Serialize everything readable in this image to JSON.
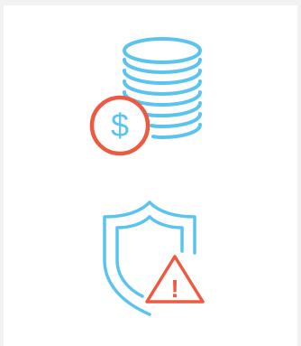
{
  "illustrations": [
    {
      "name": "coin-stack-with-dollar-icon",
      "icon": "coin-stack-dollar"
    },
    {
      "name": "shield-with-warning-icon",
      "icon": "shield-warning"
    }
  ],
  "colors": {
    "background": "#f2f2f2",
    "panel": "#ffffff",
    "primary_blue": "#5bc4ee",
    "accent_red": "#ee5a3f"
  },
  "glyphs": {
    "currency": "$",
    "warning": "!"
  }
}
